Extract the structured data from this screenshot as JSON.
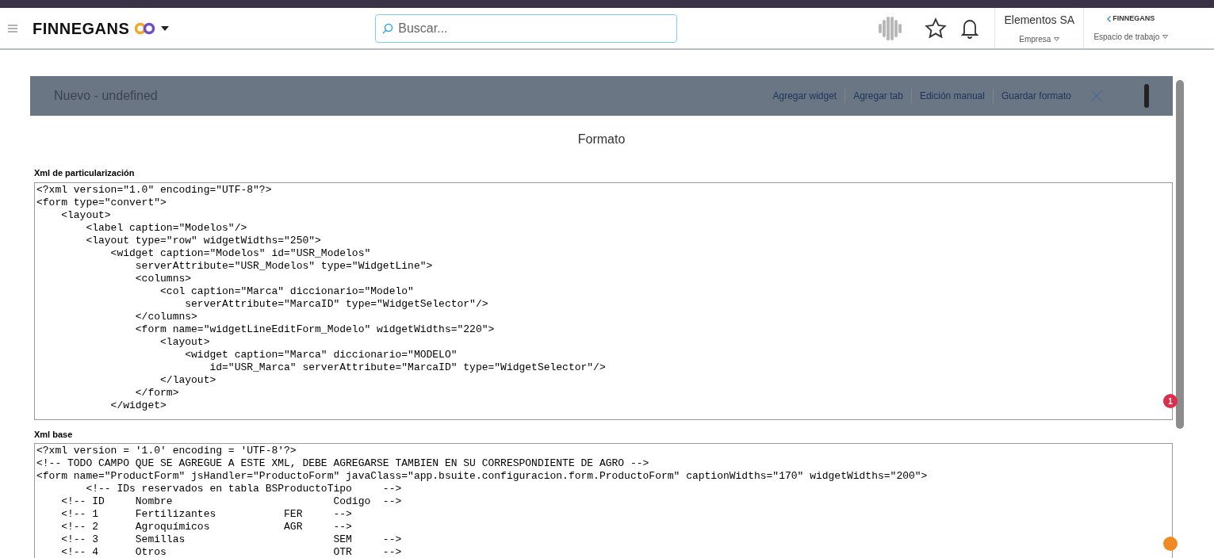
{
  "header": {
    "brand": "FINNEGANS",
    "search": {
      "placeholder": "Buscar..."
    },
    "company": {
      "name": "Elementos SA",
      "label": "Empresa"
    },
    "workspace": {
      "logo": "FINNEGANS",
      "label": "Espacio de trabajo"
    }
  },
  "modal": {
    "title": "Nuevo - undefined",
    "actions": [
      "Agregar widget",
      "Agregar tab",
      "Edición manual",
      "Guardar formato"
    ],
    "heading": "Formato",
    "editors": [
      {
        "label": "Xml de particularización",
        "lines": [
          "<?xml version=\"1.0\" encoding=\"UTF-8\"?>",
          "<form type=\"convert\">",
          "    <layout>",
          "        <label caption=\"Modelos\"/>",
          "        <layout type=\"row\" widgetWidths=\"250\">",
          "            <widget caption=\"Modelos\" id=\"USR_Modelos\"",
          "                serverAttribute=\"USR_Modelos\" type=\"WidgetLine\">",
          "                <columns>",
          "                    <col caption=\"Marca\" diccionario=\"Modelo\"",
          "                        serverAttribute=\"MarcaID\" type=\"WidgetSelector\"/>",
          "                </columns>",
          "                <form name=\"widgetLineEditForm_Modelo\" widgetWidths=\"220\">",
          "                    <layout>",
          "                        <widget caption=\"Marca\" diccionario=\"MODELO\"",
          "                            id=\"USR_Marca\" serverAttribute=\"MarcaID\" type=\"WidgetSelector\"/>",
          "                    </layout>",
          "                </form>",
          "            </widget>"
        ]
      },
      {
        "label": "Xml base",
        "lines": [
          "<?xml version = '1.0' encoding = 'UTF-8'?>",
          "<!-- TODO CAMPO QUE SE AGREGUE A ESTE XML, DEBE AGREGARSE TAMBIEN EN SU CORRESPONDIENTE DE AGRO -->",
          "<form name=\"ProductForm\" jsHandler=\"ProductoForm\" javaClass=\"app.bsuite.configuracion.form.ProductoForm\" captionWidths=\"170\" widgetWidths=\"200\">",
          "        <!-- IDs reservados en tabla BSProductoTipo     -->",
          "    <!-- ID     Nombre                          Codigo  -->",
          "    <!-- 1      Fertilizantes           FER     -->",
          "    <!-- 2      Agroquímicos            AGR     -->",
          "    <!-- 3      Semillas                        SEM     -->",
          "    <!-- 4      Otros                           OTR     -->"
        ]
      }
    ],
    "badges": [
      {
        "text": "1",
        "color": "#dc2f4f"
      },
      {
        "color": "#f08a24"
      }
    ]
  }
}
